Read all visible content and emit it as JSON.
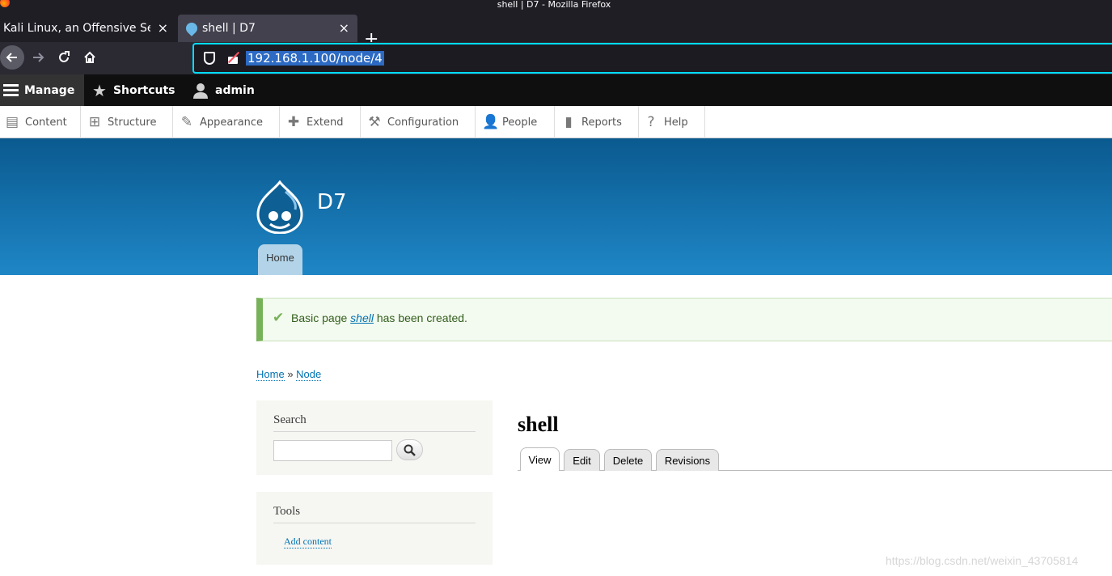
{
  "browser": {
    "window_title": "shell | D7 - Mozilla Firefox",
    "tabs": [
      {
        "title": "Kali Linux, an Offensive Security"
      },
      {
        "title": "shell | D7"
      }
    ],
    "url": "192.168.1.100/node/4",
    "tab_close": "×",
    "new_tab": "+"
  },
  "toolbar": {
    "manage": "Manage",
    "shortcuts": "Shortcuts",
    "user": "admin"
  },
  "tray": [
    {
      "label": "Content"
    },
    {
      "label": "Structure"
    },
    {
      "label": "Appearance"
    },
    {
      "label": "Extend"
    },
    {
      "label": "Configuration"
    },
    {
      "label": "People"
    },
    {
      "label": "Reports"
    },
    {
      "label": "Help"
    }
  ],
  "site": {
    "name": "D7",
    "home_tab": "Home"
  },
  "status": {
    "prefix": "Basic page",
    "link": "shell",
    "suffix": "has been created."
  },
  "breadcrumb": {
    "home": "Home",
    "separator": "»",
    "node": "Node"
  },
  "sidebar": {
    "search_title": "Search",
    "tools_title": "Tools",
    "add_content": "Add content"
  },
  "node": {
    "title": "shell",
    "tabs": [
      {
        "label": "View"
      },
      {
        "label": "Edit"
      },
      {
        "label": "Delete"
      },
      {
        "label": "Revisions"
      }
    ]
  },
  "watermark": "https://blog.csdn.net/weixin_43705814",
  "colors": {
    "accent": "#0071b3",
    "header_top": "#0a5a8f",
    "header_bottom": "#1f86c6",
    "status_green": "#77b259"
  }
}
